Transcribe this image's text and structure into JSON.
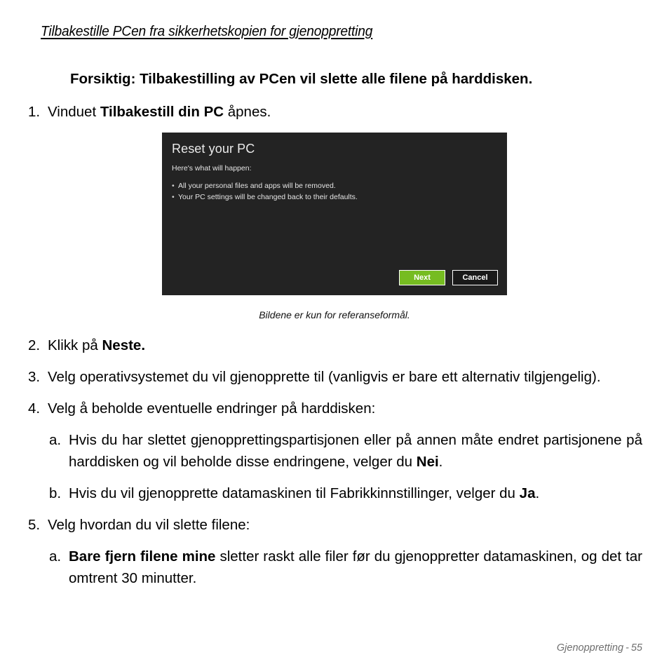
{
  "document": {
    "section_heading": "Tilbakestille PCen fra sikkerhetskopien for gjenoppretting",
    "caution": {
      "label": "Forsiktig:",
      "text": "Tilbakestilling av PCen vil slette alle filene på harddisken."
    }
  },
  "steps": [
    {
      "marker": "1.",
      "type": "number",
      "pre": "Vinduet ",
      "bold": "Tilbakestill din PC",
      "post": " åpnes."
    },
    {
      "marker": "2.",
      "type": "number",
      "pre": "Klikk på ",
      "bold": "Neste.",
      "post": ""
    },
    {
      "marker": "3.",
      "type": "number",
      "pre": "Velg operativsystemet du vil gjenopprette til (vanligvis er bare ett alternativ tilgjengelig).",
      "bold": "",
      "post": ""
    },
    {
      "marker": "4.",
      "type": "number",
      "pre": "Velg å beholde eventuelle endringer på harddisken:",
      "bold": "",
      "post": ""
    },
    {
      "marker": "a.",
      "type": "letter",
      "pre": "Hvis du har slettet gjenopprettingspartisjonen eller på annen måte endret partisjonene på harddisken og vil beholde disse endringene, velger du ",
      "bold": "Nei",
      "post": "."
    },
    {
      "marker": "b.",
      "type": "letter",
      "pre": "Hvis du vil gjenopprette datamaskinen til Fabrikkinnstillinger, velger du ",
      "bold": "Ja",
      "post": "."
    },
    {
      "marker": "5.",
      "type": "number",
      "pre": "Velg hvordan du vil slette filene:",
      "bold": "",
      "post": ""
    },
    {
      "marker": "a.",
      "type": "letter",
      "pre": "",
      "bold": "Bare fjern filene mine",
      "post": " sletter raskt alle filer før du gjenoppretter datamaskinen, og det tar omtrent 30 minutter."
    }
  ],
  "figure": {
    "screenshot": {
      "title": "Reset your PC",
      "subtitle": "Here's what will happen:",
      "bullets": [
        "All your personal files and apps will be removed.",
        "Your PC settings will be changed back to their defaults."
      ],
      "bullet_glyph": "•",
      "buttons": {
        "next": "Next",
        "cancel": "Cancel"
      },
      "colors": {
        "background": "#232323",
        "next_button": "#76bc21",
        "cancel_button": "#191919",
        "text": "#e4e4e4"
      }
    },
    "caption": "Bildene er kun for referanseformål."
  },
  "footer": {
    "chapter": "Gjenoppretting",
    "separator": "-",
    "page": "55"
  }
}
